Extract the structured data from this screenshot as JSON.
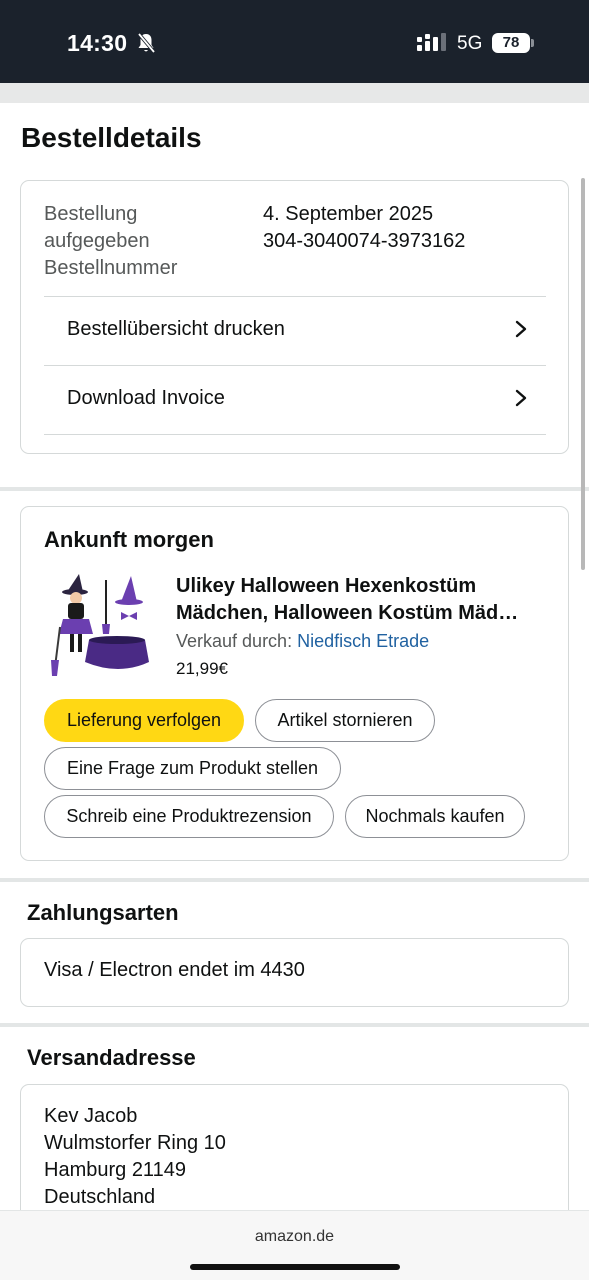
{
  "status_bar": {
    "time": "14:30",
    "icons": [
      "bell-slash-icon",
      "signal-icon"
    ],
    "network": "5G",
    "battery": "78"
  },
  "page": {
    "title": "Bestelldetails"
  },
  "order_info": {
    "label_lines": [
      "Bestellung",
      "aufgegeben",
      "Bestellnummer"
    ],
    "date": "4. September 2025",
    "number": "304-3040074-3973162",
    "links": [
      {
        "label": "Bestellübersicht drucken",
        "icon": "chevron-right-icon"
      },
      {
        "label": "Download Invoice",
        "icon": "chevron-right-icon"
      }
    ]
  },
  "arrival": {
    "title": "Ankunft morgen",
    "product": {
      "title_line1": "Ulikey Halloween Hexenkostüm",
      "title_line2": "Mädchen, Halloween Kostüm Mäd…",
      "seller_prefix": "Verkauf durch:",
      "seller_name": "Niedfisch Etrade",
      "price": "21,99€"
    },
    "buttons": {
      "track": "Lieferung verfolgen",
      "cancel": "Artikel stornieren",
      "question": "Eine Frage zum Produkt stellen",
      "review": "Schreib eine Produktrezension",
      "buy_again": "Nochmals kaufen"
    },
    "colors": {
      "primary_button": "#ffd814",
      "link": "#2162a1"
    }
  },
  "payment": {
    "title": "Zahlungsarten",
    "method": "Visa / Electron",
    "ending": "endet im 4430"
  },
  "shipping": {
    "title": "Versandadresse",
    "lines": [
      "Kev Jacob",
      "Wulmstorfer Ring 10",
      "Hamburg 21149",
      "Deutschland"
    ]
  },
  "browser": {
    "url": "amazon.de"
  }
}
